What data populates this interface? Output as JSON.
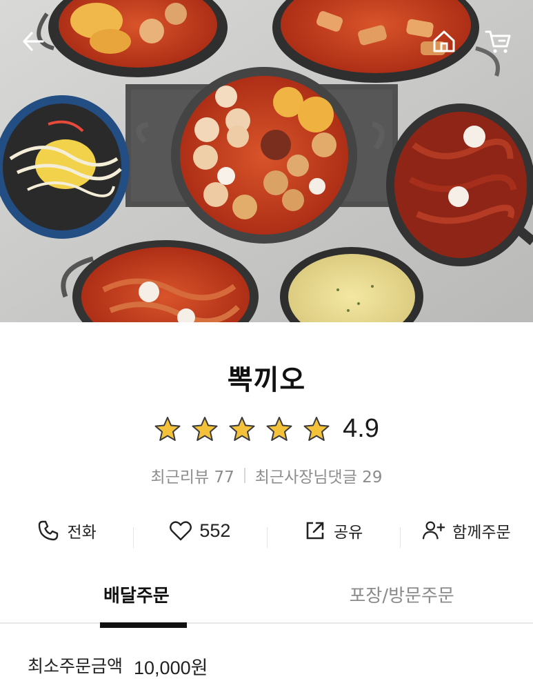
{
  "hero": {
    "image_alt": "food-photo",
    "colors": {
      "sauce": "#c2391c",
      "pot": "#3b3a39",
      "table": "#d0d0ce"
    }
  },
  "nav": {
    "back_icon": "back-arrow-icon",
    "home_icon": "home-icon",
    "cart_icon": "cart-icon"
  },
  "store": {
    "name": "뽁끼오",
    "rating": "4.9",
    "rating_stars": 5,
    "review_label": "최근리뷰 77",
    "owner_reply_label": "최근사장님댓글 29",
    "star_color": "#f3c13a"
  },
  "actions": [
    {
      "icon": "phone-icon",
      "label": "전화"
    },
    {
      "icon": "heart-icon",
      "label": "552"
    },
    {
      "icon": "share-icon",
      "label": "공유"
    },
    {
      "icon": "add-person-icon",
      "label": "함께주문"
    }
  ],
  "tabs": [
    {
      "label": "배달주문",
      "active": true
    },
    {
      "label": "포장/방문주문",
      "active": false
    }
  ],
  "min_order": {
    "label": "최소주문금액",
    "amount": "10,000원"
  }
}
